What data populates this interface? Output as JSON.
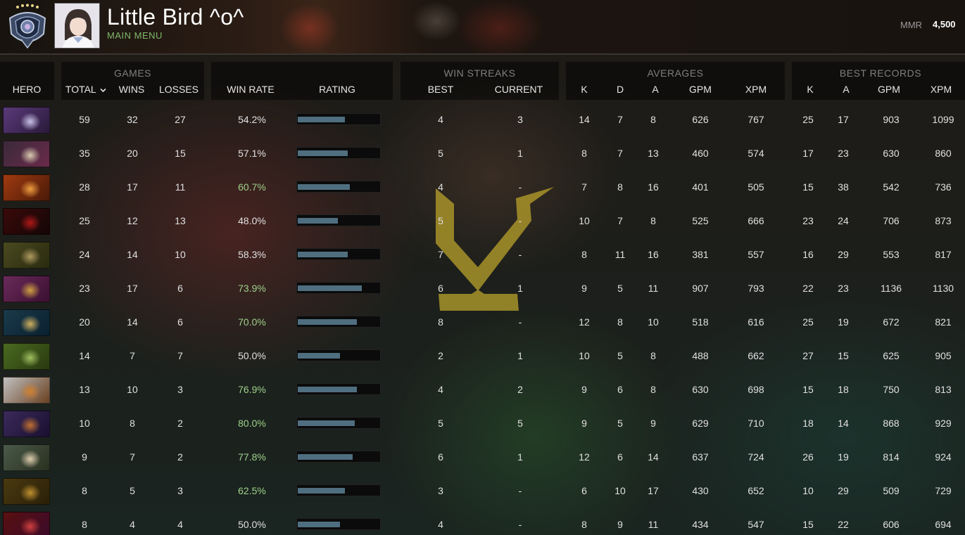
{
  "header": {
    "player_name": "Little Bird ^o^",
    "menu_link": "MAIN MENU",
    "mmr_label": "MMR",
    "mmr_value": "4,500",
    "rank_icon": "rank-medal-icon",
    "avatar": "player-avatar"
  },
  "groups": {
    "games": "GAMES",
    "win_streaks": "WIN STREAKS",
    "averages": "AVERAGES",
    "best_records": "BEST RECORDS"
  },
  "columns": {
    "hero": "HERO",
    "total": "TOTAL",
    "sort_icon": "chevron-down-icon",
    "wins": "WINS",
    "losses": "LOSSES",
    "win_rate": "WIN RATE",
    "rating": "RATING",
    "best": "BEST",
    "current": "CURRENT",
    "avg_k": "K",
    "avg_d": "D",
    "avg_a": "A",
    "avg_gpm": "GPM",
    "avg_xpm": "XPM",
    "best_k": "K",
    "best_a": "A",
    "best_gpm": "GPM",
    "best_xpm": "XPM"
  },
  "colors": {
    "winrate_good": "#9fd18a",
    "winrate_normal": "#e0e0e0",
    "rating_fill": "#4f6f80",
    "menu_link": "#7fb86a"
  },
  "rows": [
    {
      "total": "59",
      "wins": "32",
      "losses": "27",
      "win_rate": "54.2%",
      "rating": 0.57,
      "best": "4",
      "current": "3",
      "k": "14",
      "d": "7",
      "a": "8",
      "gpm": "626",
      "xpm": "767",
      "bk": "25",
      "ba": "17",
      "bgpm": "903",
      "bxpm": "1099"
    },
    {
      "total": "35",
      "wins": "20",
      "losses": "15",
      "win_rate": "57.1%",
      "rating": 0.6,
      "best": "5",
      "current": "1",
      "k": "8",
      "d": "7",
      "a": "13",
      "gpm": "460",
      "xpm": "574",
      "bk": "17",
      "ba": "23",
      "bgpm": "630",
      "bxpm": "860"
    },
    {
      "total": "28",
      "wins": "17",
      "losses": "11",
      "win_rate": "60.7%",
      "rating": 0.63,
      "best": "4",
      "current": "-",
      "k": "7",
      "d": "8",
      "a": "16",
      "gpm": "401",
      "xpm": "505",
      "bk": "15",
      "ba": "38",
      "bgpm": "542",
      "bxpm": "736"
    },
    {
      "total": "25",
      "wins": "12",
      "losses": "13",
      "win_rate": "48.0%",
      "rating": 0.48,
      "best": "5",
      "current": "-",
      "k": "10",
      "d": "7",
      "a": "8",
      "gpm": "525",
      "xpm": "666",
      "bk": "23",
      "ba": "24",
      "bgpm": "706",
      "bxpm": "873"
    },
    {
      "total": "24",
      "wins": "14",
      "losses": "10",
      "win_rate": "58.3%",
      "rating": 0.6,
      "best": "7",
      "current": "-",
      "k": "8",
      "d": "11",
      "a": "16",
      "gpm": "381",
      "xpm": "557",
      "bk": "16",
      "ba": "29",
      "bgpm": "553",
      "bxpm": "817"
    },
    {
      "total": "23",
      "wins": "17",
      "losses": "6",
      "win_rate": "73.9%",
      "rating": 0.77,
      "best": "6",
      "current": "1",
      "k": "9",
      "d": "5",
      "a": "11",
      "gpm": "907",
      "xpm": "793",
      "bk": "22",
      "ba": "23",
      "bgpm": "1136",
      "bxpm": "1130"
    },
    {
      "total": "20",
      "wins": "14",
      "losses": "6",
      "win_rate": "70.0%",
      "rating": 0.71,
      "best": "8",
      "current": "-",
      "k": "12",
      "d": "8",
      "a": "10",
      "gpm": "518",
      "xpm": "616",
      "bk": "25",
      "ba": "19",
      "bgpm": "672",
      "bxpm": "821"
    },
    {
      "total": "14",
      "wins": "7",
      "losses": "7",
      "win_rate": "50.0%",
      "rating": 0.51,
      "best": "2",
      "current": "1",
      "k": "10",
      "d": "5",
      "a": "8",
      "gpm": "488",
      "xpm": "662",
      "bk": "27",
      "ba": "15",
      "bgpm": "625",
      "bxpm": "905"
    },
    {
      "total": "13",
      "wins": "10",
      "losses": "3",
      "win_rate": "76.9%",
      "rating": 0.71,
      "best": "4",
      "current": "2",
      "k": "9",
      "d": "6",
      "a": "8",
      "gpm": "630",
      "xpm": "698",
      "bk": "15",
      "ba": "18",
      "bgpm": "750",
      "bxpm": "813"
    },
    {
      "total": "10",
      "wins": "8",
      "losses": "2",
      "win_rate": "80.0%",
      "rating": 0.69,
      "best": "5",
      "current": "5",
      "k": "9",
      "d": "5",
      "a": "9",
      "gpm": "629",
      "xpm": "710",
      "bk": "18",
      "ba": "14",
      "bgpm": "868",
      "bxpm": "929"
    },
    {
      "total": "9",
      "wins": "7",
      "losses": "2",
      "win_rate": "77.8%",
      "rating": 0.66,
      "best": "6",
      "current": "1",
      "k": "12",
      "d": "6",
      "a": "14",
      "gpm": "637",
      "xpm": "724",
      "bk": "26",
      "ba": "19",
      "bgpm": "814",
      "bxpm": "924"
    },
    {
      "total": "8",
      "wins": "5",
      "losses": "3",
      "win_rate": "62.5%",
      "rating": 0.57,
      "best": "3",
      "current": "-",
      "k": "6",
      "d": "10",
      "a": "17",
      "gpm": "430",
      "xpm": "652",
      "bk": "10",
      "ba": "29",
      "bgpm": "509",
      "bxpm": "729"
    },
    {
      "total": "8",
      "wins": "4",
      "losses": "4",
      "win_rate": "50.0%",
      "rating": 0.51,
      "best": "4",
      "current": "-",
      "k": "8",
      "d": "9",
      "a": "11",
      "gpm": "434",
      "xpm": "547",
      "bk": "15",
      "ba": "22",
      "bgpm": "606",
      "bxpm": "694"
    }
  ]
}
